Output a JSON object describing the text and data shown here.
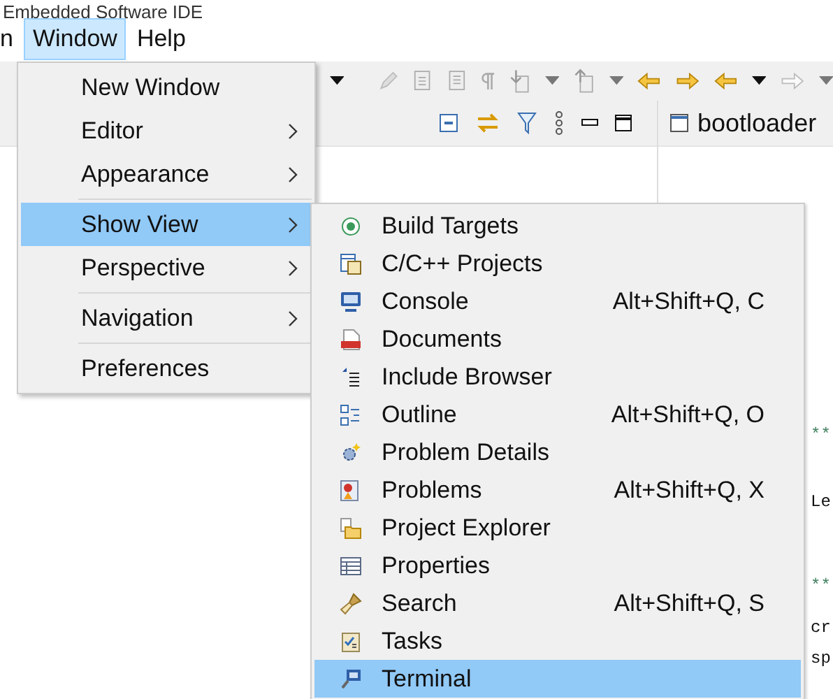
{
  "window": {
    "title": "Embedded Software IDE"
  },
  "menu_bar": [
    {
      "label": "n",
      "selected": false
    },
    {
      "label": "Window",
      "selected": true
    },
    {
      "label": "Help",
      "selected": false
    }
  ],
  "editor_tab": {
    "label": "bootloader"
  },
  "editor_lines": [
    {
      "text": "**",
      "kind": "comment"
    },
    {
      "text": "Le",
      "kind": "code"
    },
    {
      "text": "**",
      "kind": "comment"
    },
    {
      "text": "cr",
      "kind": "code"
    },
    {
      "text": "sp",
      "kind": "code"
    }
  ],
  "window_menu": [
    {
      "label": "New Window",
      "submenu": false,
      "selected": false,
      "separator_before": false
    },
    {
      "label": "Editor",
      "submenu": true,
      "selected": false,
      "separator_before": false
    },
    {
      "label": "Appearance",
      "submenu": true,
      "selected": false,
      "separator_before": false
    },
    {
      "label": "Show View",
      "submenu": true,
      "selected": true,
      "separator_before": true
    },
    {
      "label": "Perspective",
      "submenu": true,
      "selected": false,
      "separator_before": false
    },
    {
      "label": "Navigation",
      "submenu": true,
      "selected": false,
      "separator_before": true
    },
    {
      "label": "Preferences",
      "submenu": false,
      "selected": false,
      "separator_before": true
    }
  ],
  "show_view_menu": [
    {
      "label": "Build Targets",
      "kind": "target",
      "selected": false
    },
    {
      "label": "C/C++ Projects",
      "kind": "projects",
      "selected": false
    },
    {
      "label": "Console",
      "kind": "monitor",
      "selected": false,
      "shortcut": "Alt+Shift+Q, C"
    },
    {
      "label": "Documents",
      "kind": "pdf",
      "selected": false
    },
    {
      "label": "Include Browser",
      "kind": "list",
      "selected": false
    },
    {
      "label": "Outline",
      "kind": "outline",
      "selected": false,
      "shortcut": "Alt+Shift+Q, O"
    },
    {
      "label": "Problem Details",
      "kind": "details",
      "selected": false
    },
    {
      "label": "Problems",
      "kind": "problems",
      "selected": false,
      "shortcut": "Alt+Shift+Q, X"
    },
    {
      "label": "Project Explorer",
      "kind": "folder",
      "selected": false
    },
    {
      "label": "Properties",
      "kind": "table",
      "selected": false
    },
    {
      "label": "Search",
      "kind": "torch",
      "selected": false,
      "shortcut": "Alt+Shift+Q, S"
    },
    {
      "label": "Tasks",
      "kind": "clipboard",
      "selected": false
    },
    {
      "label": "Terminal",
      "kind": "terminal",
      "selected": true
    }
  ]
}
